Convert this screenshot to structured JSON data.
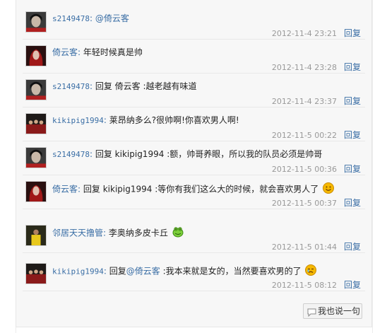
{
  "comments": [
    {
      "user": "s2149478",
      "sep": ":",
      "mention": "@倚云客",
      "reply_prefix": "",
      "text": "",
      "time": "2012-11-4 23:21",
      "reply": "回复",
      "avatar": "portrait-dark"
    },
    {
      "user": "倚云客",
      "sep": ":",
      "mention": "",
      "reply_prefix": "",
      "text": "年轻时候真是帅",
      "time": "2012-11-4 23:28",
      "reply": "回复",
      "avatar": "portrait-red"
    },
    {
      "user": "s2149478",
      "sep": ":",
      "mention": "",
      "reply_prefix": "回复 倚云客",
      "text": ":越老越有味道",
      "time": "2012-11-4 23:37",
      "reply": "回复",
      "avatar": "portrait-dark"
    },
    {
      "user": "kikipig1994",
      "sep": ":",
      "mention": "",
      "reply_prefix": "",
      "text": "莱昂纳多么?很帅啊!你喜欢男人啊!",
      "time": "2012-11-5 00:22",
      "reply": "回复",
      "avatar": "portrait-team"
    },
    {
      "user": "s2149478",
      "sep": ":",
      "mention": "",
      "reply_prefix": "回复 kikipig1994",
      "text": ":额，帅哥养眼，所以我的队员必须是帅哥",
      "time": "2012-11-5 00:36",
      "reply": "回复",
      "avatar": "portrait-dark"
    },
    {
      "user": "倚云客",
      "sep": ":",
      "mention": "",
      "reply_prefix": "回复 kikipig1994",
      "text": ":等你有我们这么大的时候，就会喜欢男人了",
      "time": "2012-11-5 00:37",
      "reply": "回复",
      "avatar": "portrait-red",
      "emoji": "smile-emoji"
    },
    {
      "user": "邻居天天撸管",
      "sep": ":",
      "mention": "",
      "reply_prefix": "",
      "text": "李奥纳多皮卡丘",
      "time": "2012-11-5 01:44",
      "reply": "回复",
      "avatar": "portrait-yellow",
      "emoji": "frog-emoji"
    },
    {
      "user": "kikipig1994",
      "sep": ":",
      "mention": "@倚云客",
      "reply_prefix": "回复",
      "text": ":我本来就是女的，当然要喜欢男的了",
      "time": "2012-11-5 08:12",
      "reply": "回复",
      "avatar": "portrait-team",
      "emoji": "cry-emoji"
    }
  ],
  "say_button": {
    "label": "我也说一句",
    "icon": "speech-bubble-icon"
  }
}
